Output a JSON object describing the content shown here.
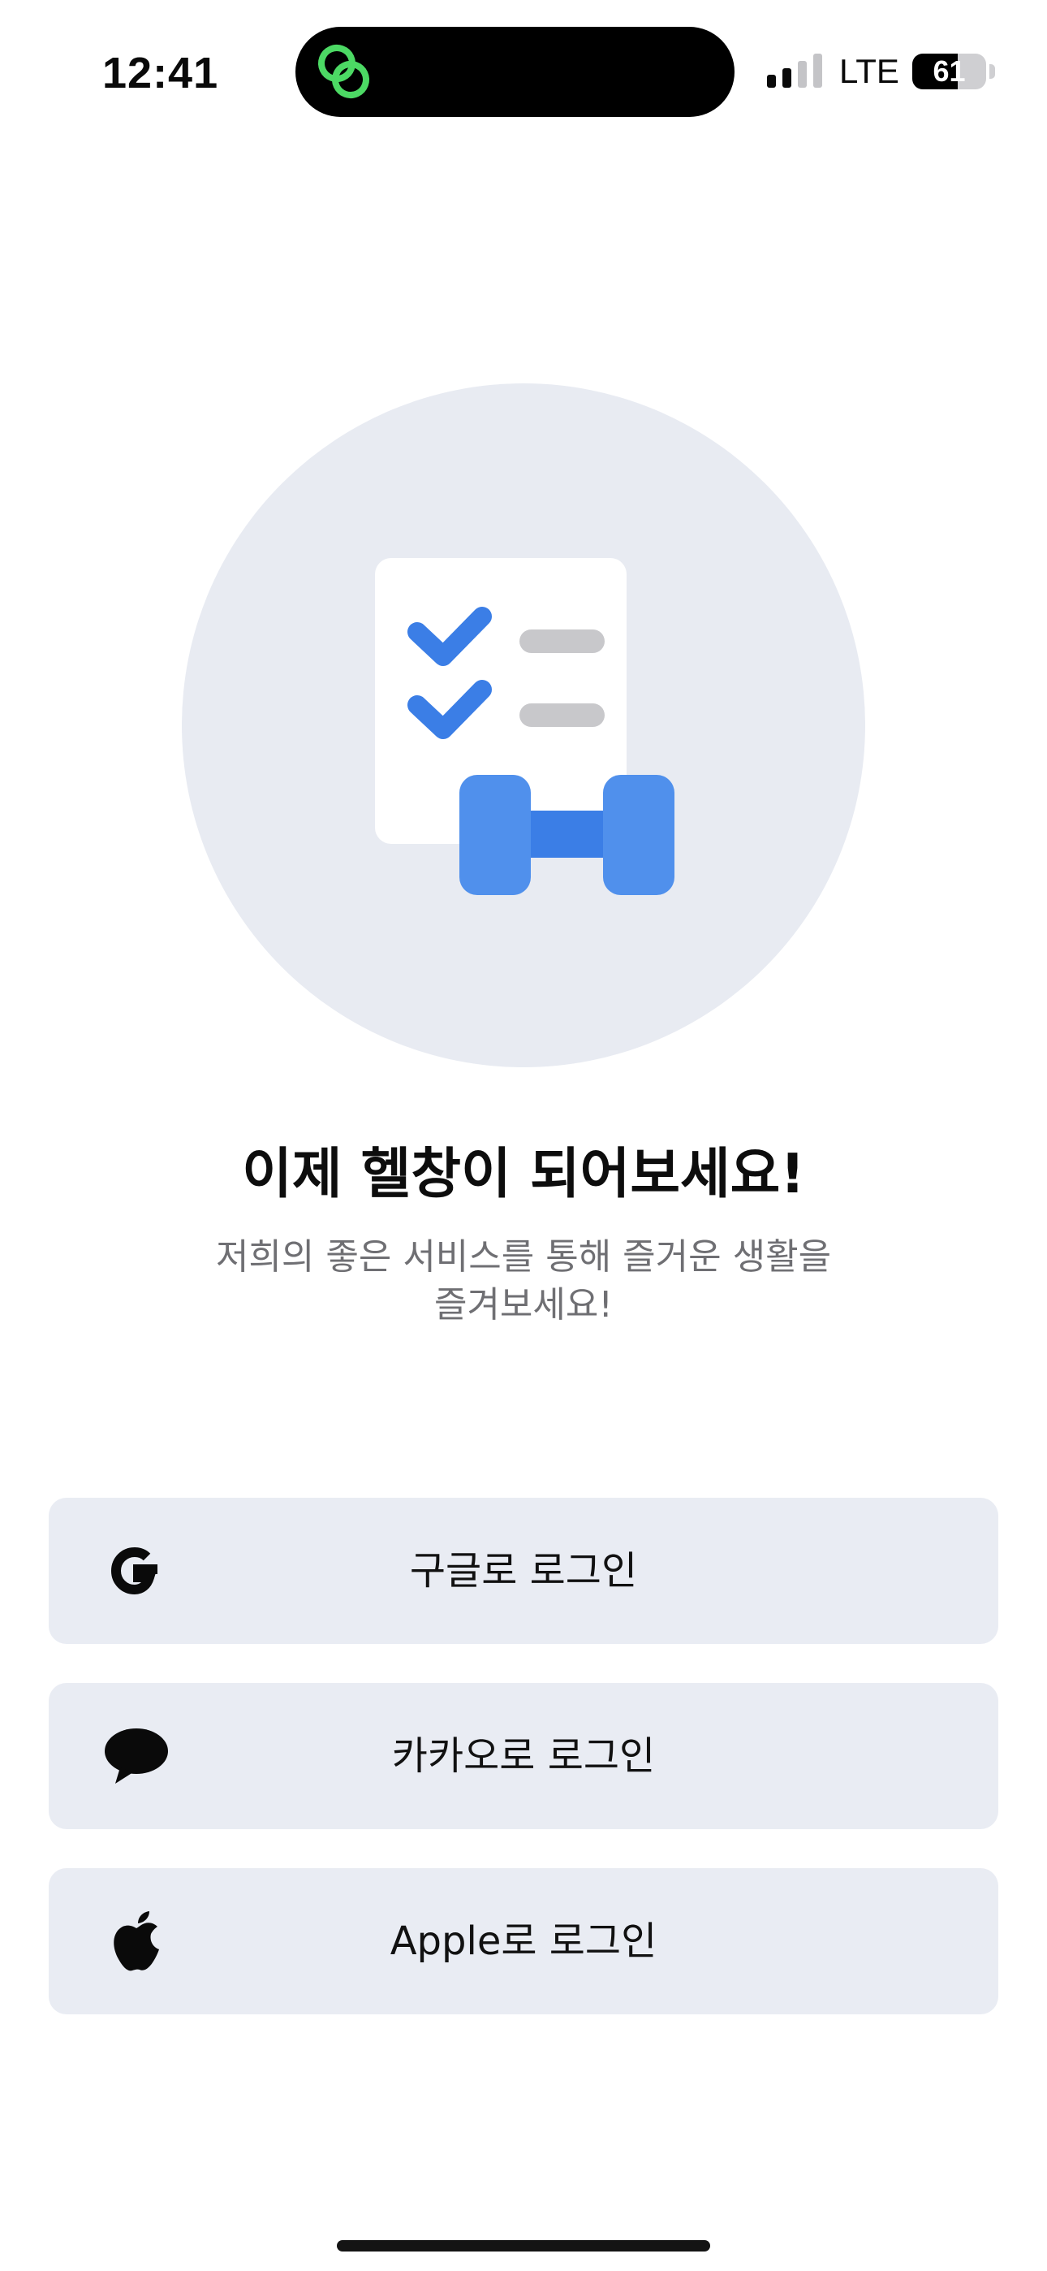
{
  "status_bar": {
    "time": "12:41",
    "network": "LTE",
    "battery_level": "61",
    "battery_fraction": 0.61,
    "signal_bars_active": 2,
    "signal_bars_total": 4,
    "island_icon": "green-link-icon"
  },
  "hero": {
    "illustration": "checklist-dumbbell-illustration",
    "title": "이제 헬창이 되어보세요!",
    "subtitle": "저희의 좋은 서비스를 통해 즐거운 생활을 즐겨보세요!"
  },
  "login_options": [
    {
      "label": "구글로 로그인",
      "icon": "google-icon"
    },
    {
      "label": "카카오로 로그인",
      "icon": "kakao-chat-icon"
    },
    {
      "label": "Apple로 로그인",
      "icon": "apple-icon"
    }
  ],
  "colors": {
    "accent_blue": "#3b7ee6",
    "button_bg": "#e9ecf3",
    "hero_bg": "#e8ebf2",
    "island_icon_green": "#4cd964"
  }
}
